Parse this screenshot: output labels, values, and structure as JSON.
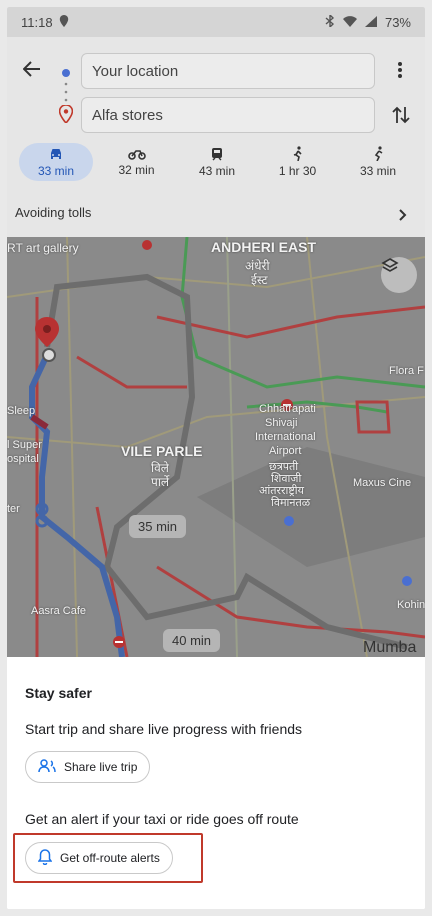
{
  "status_bar": {
    "time": "11:18",
    "battery": "73%"
  },
  "route": {
    "from": "Your location",
    "to": "Alfa stores"
  },
  "modes": [
    {
      "label": "33 min",
      "icon": "car-icon",
      "active": true
    },
    {
      "label": "32 min",
      "icon": "motorcycle-icon",
      "active": false
    },
    {
      "label": "43 min",
      "icon": "transit-icon",
      "active": false
    },
    {
      "label": "1 hr 30",
      "icon": "walk-icon",
      "active": false
    },
    {
      "label": "33 min",
      "icon": "bike-icon",
      "active": false
    }
  ],
  "avoiding": "Avoiding tolls",
  "map": {
    "labels": {
      "gallery": "RT art gallery",
      "andheri": "ANDHERI EAST",
      "andheri_dev_1": "अंधेरी",
      "andheri_dev_2": "ईस्ट",
      "vile_parle": "VILE PARLE",
      "vile_dev_1": "विले",
      "vile_dev_2": "पार्ले",
      "airport_1": "Chhatrapati",
      "airport_2": "Shivaji",
      "airport_3": "International",
      "airport_4": "Airport",
      "airport_dev_1": "छत्रपती",
      "airport_dev_2": "शिवाजी",
      "airport_dev_3": "आंतरराष्ट्रीय",
      "airport_dev_4": "विमानतळ",
      "hospital_1": "l Super",
      "hospital_2": "ospital",
      "flora": "Flora F",
      "maxus": "Maxus Cine",
      "aasra": "Aasra Cafe",
      "mumbai": "Mumba",
      "kohin": "Kohin",
      "ter": "ter",
      "sleep": "Sleep"
    },
    "times": {
      "primary": "35 min",
      "alt": "40 min"
    }
  },
  "sheet": {
    "title": "Stay safer",
    "share_text": "Start trip and share live progress with friends",
    "share_button": "Share live trip",
    "alert_text": "Get an alert if your taxi or ride goes off route",
    "alert_button": "Get off-route alerts"
  },
  "colors": {
    "accent": "#1a73e8",
    "highlight": "#c0392b"
  }
}
